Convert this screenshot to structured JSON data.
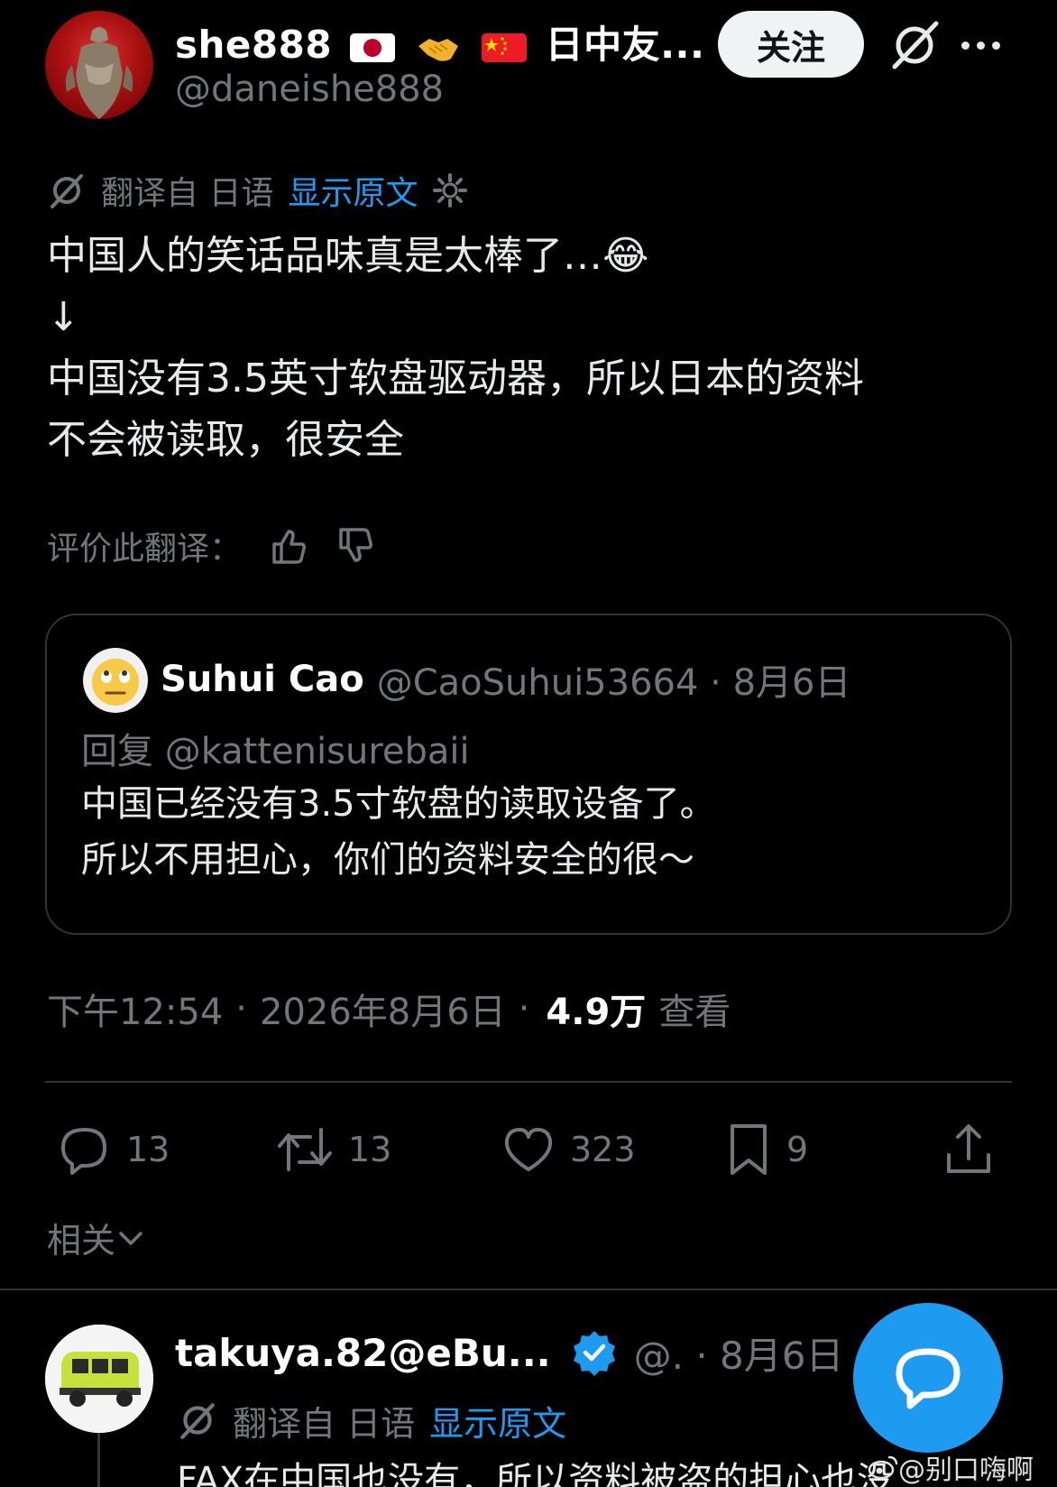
{
  "author": {
    "display_name_prefix": "she888",
    "display_name_suffix": "日中友...",
    "handle": "@daneishe888",
    "follow_label": "关注"
  },
  "translation": {
    "label": "翻译自 日语",
    "show_original": "显示原文"
  },
  "tweet": {
    "line1": "中国人的笑话品味真是太棒了…😂",
    "line2": "↓",
    "line3": "中国没有3.5英寸软盘驱动器，所以日本的资料",
    "line4": "不会被读取，很安全"
  },
  "rate": {
    "label": "评价此翻译："
  },
  "quote": {
    "name": "Suhui Cao",
    "meta": "@CaoSuhui53664 · 8月6日",
    "reply_to": "回复 @kattenisurebaii",
    "line1": "中国已经没有3.5寸软盘的读取设备了。",
    "line2": "所以不用担心，你们的资料安全的很～"
  },
  "meta": {
    "time": "下午12:54",
    "date": "2026年8月6日",
    "views_count": "4.9万",
    "views_label": "查看"
  },
  "actions": {
    "replies": "13",
    "reposts": "13",
    "likes": "323",
    "bookmarks": "9"
  },
  "related": {
    "label": "相关"
  },
  "reply": {
    "name": "takuya.82@eBu...",
    "meta": "@. · 8月6日",
    "translation_label": "翻译自 日语",
    "show_original": "显示原文",
    "text": "FAX在中国也没有，所以资料被盗的担心也没"
  },
  "watermark": "@别口嗨啊",
  "colors": {
    "background": "#000000",
    "accent": "#1d9bf0",
    "muted": "#71767b",
    "text": "#e7e9ea",
    "border": "#2f3336"
  }
}
